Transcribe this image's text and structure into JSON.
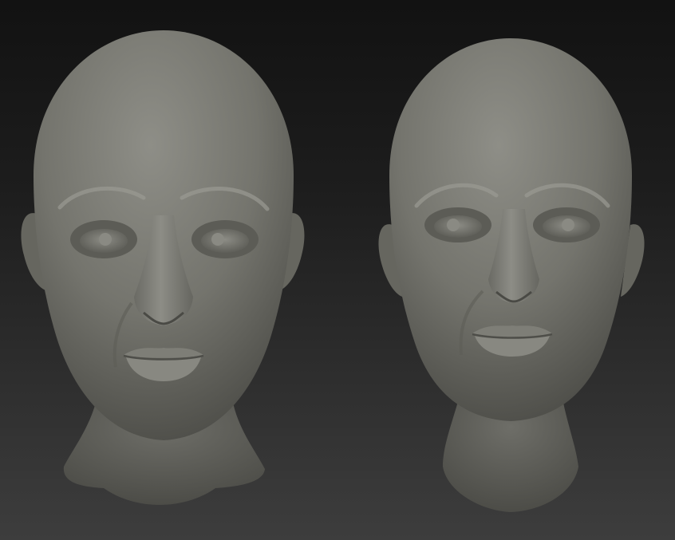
{
  "scene": {
    "background_top": "#121212",
    "background_bottom": "#3d3d3d",
    "clay_color": "#808078",
    "models": [
      {
        "name": "head-sculpt-left"
      },
      {
        "name": "head-sculpt-right"
      }
    ]
  }
}
